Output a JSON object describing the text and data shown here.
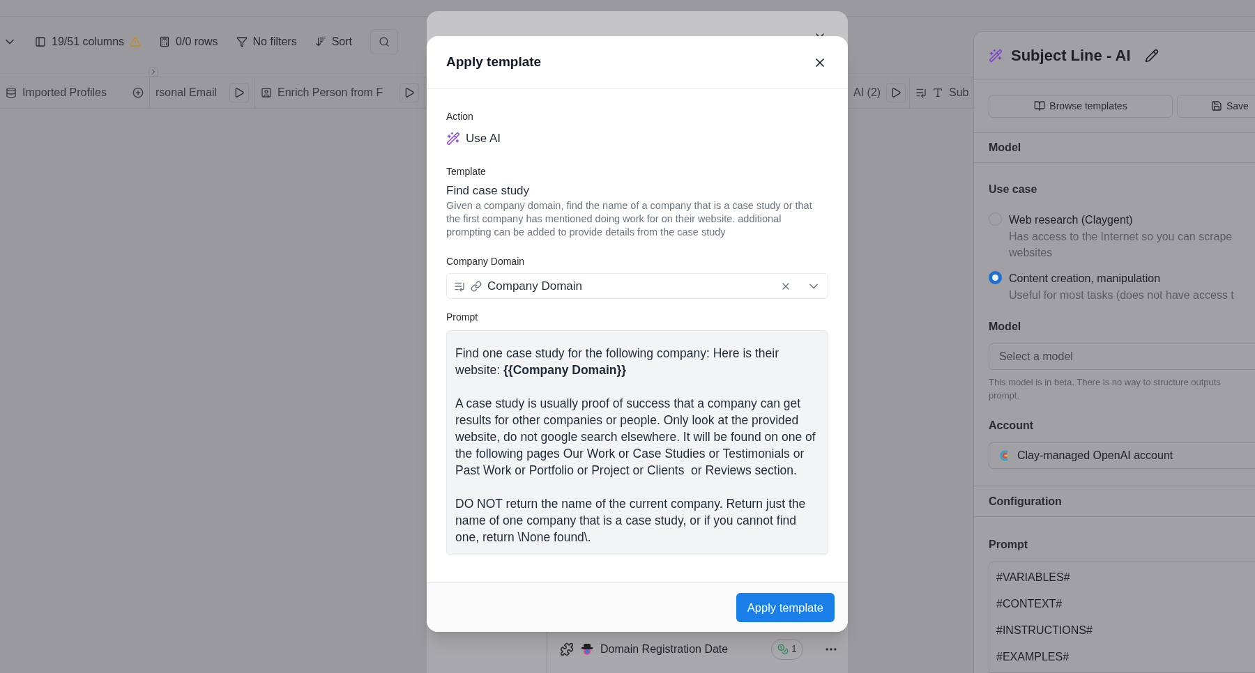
{
  "toolbar": {
    "items": [
      {
        "kind": "columns",
        "label": "19/51 columns",
        "warning": true
      },
      {
        "kind": "rows",
        "label": "0/0 rows",
        "warning": false
      },
      {
        "kind": "filter",
        "label": "No filters",
        "warning": false
      },
      {
        "kind": "sort",
        "label": "Sort",
        "warning": false
      }
    ]
  },
  "column_headers_left": [
    {
      "kind": "source",
      "label": "Imported Profiles"
    },
    {
      "kind": "run",
      "label": "rsonal Email"
    },
    {
      "kind": "enrich",
      "label": "Enrich Person from F"
    }
  ],
  "column_headers_right": [
    {
      "kind": "run",
      "label": "AI (2)"
    },
    {
      "kind": "text",
      "label": "Sub"
    }
  ],
  "back_dialog": {
    "rows": [
      {
        "label": "Domain Registration Date",
        "count": "1"
      }
    ]
  },
  "dialog": {
    "title": "Apply template",
    "action": {
      "label": "Action",
      "value": "Use AI"
    },
    "template": {
      "label": "Template",
      "name": "Find case study",
      "description": "Given a company domain, find the name of a company that is a case study or that the first company has mentioned doing work for on their website. additional prompting can be added to provide details from the case study"
    },
    "input": {
      "label": "Company Domain",
      "value": "Company Domain"
    },
    "prompt": {
      "label": "Prompt",
      "paragraphs": [
        "Find one case study for the following company: Here is their website: **{{Company Domain}}**",
        "A case study is usually proof of success that a company can get results for other companies or people. Only look at the provided website, do not google search elsewhere. It will be found on one of the following pages Our Work or Case Studies or Testimonials or Past Work or Portfolio or Project or Clients  or Reviews section.",
        "DO NOT return the name of the current company. Return just the name of one company that is a case study, or if you cannot find one, return \\None found\\."
      ]
    },
    "submit": "Apply template"
  },
  "side_panel": {
    "title": "Subject Line - AI",
    "buttons": [
      "Browse templates",
      "Save"
    ],
    "section": "Model",
    "use_case": {
      "label": "Use case",
      "options": [
        {
          "label": "Web research (Claygent)",
          "description": [
            "Has access to the Internet so you can scrape",
            "websites"
          ],
          "selected": false
        },
        {
          "label": "Content creation, manipulation",
          "description": [
            "Useful for most tasks (does not have access t"
          ],
          "selected": true
        }
      ]
    },
    "model": {
      "label": "Model",
      "placeholder": "Select a model",
      "hint": [
        "This model is in beta. There is no way to structure outputs",
        "prompt."
      ]
    },
    "account": {
      "label": "Account",
      "value": "Clay-managed OpenAI account"
    },
    "configuration": "Configuration",
    "prompt": {
      "label": "Prompt",
      "lines": [
        "#VARIABLES#",
        "#CONTEXT#",
        "#INSTRUCTIONS#",
        "#EXAMPLES#"
      ]
    }
  }
}
